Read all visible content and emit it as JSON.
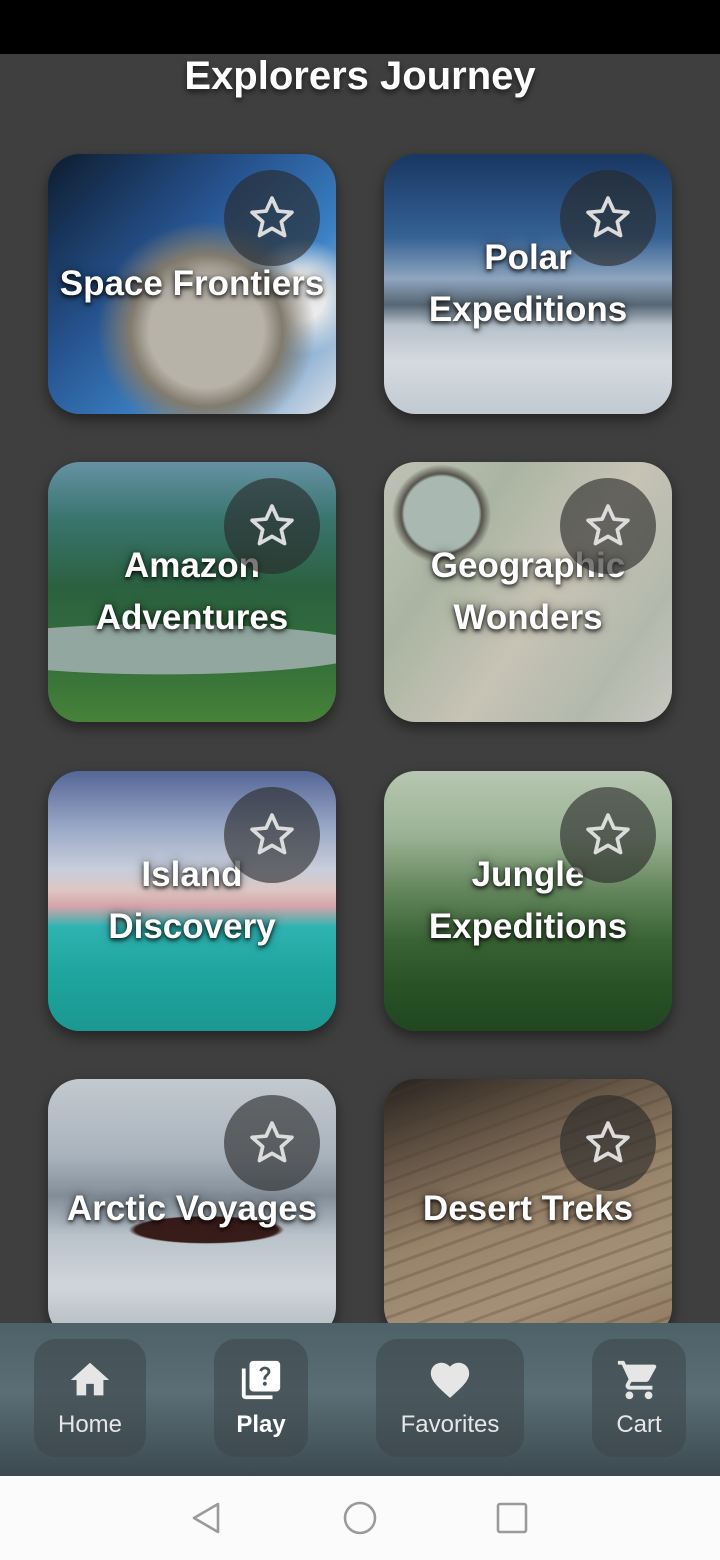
{
  "page": {
    "title": "Explorers Journey"
  },
  "cards": [
    {
      "label": "Space Frontiers",
      "favorited": false
    },
    {
      "label": "Polar Expeditions",
      "favorited": false
    },
    {
      "label": "Amazon Adventures",
      "favorited": false
    },
    {
      "label": "Geographic Wonders",
      "favorited": false
    },
    {
      "label": "Island Discovery",
      "favorited": false
    },
    {
      "label": "Jungle Expeditions",
      "favorited": false
    },
    {
      "label": "Arctic Voyages",
      "favorited": false
    },
    {
      "label": "Desert Treks",
      "favorited": false
    }
  ],
  "nav": {
    "items": [
      {
        "label": "Home",
        "icon": "home-icon"
      },
      {
        "label": "Play",
        "icon": "quiz-icon",
        "active": true
      },
      {
        "label": "Favorites",
        "icon": "heart-icon"
      },
      {
        "label": "Cart",
        "icon": "cart-icon"
      }
    ]
  },
  "system_nav": {
    "icons": [
      "back-triangle-icon",
      "home-circle-icon",
      "recents-square-icon"
    ]
  },
  "colors": {
    "background": "#3f3f3f",
    "nav_bar": "#5b6e75",
    "star_outline": "#dcdcdc"
  }
}
